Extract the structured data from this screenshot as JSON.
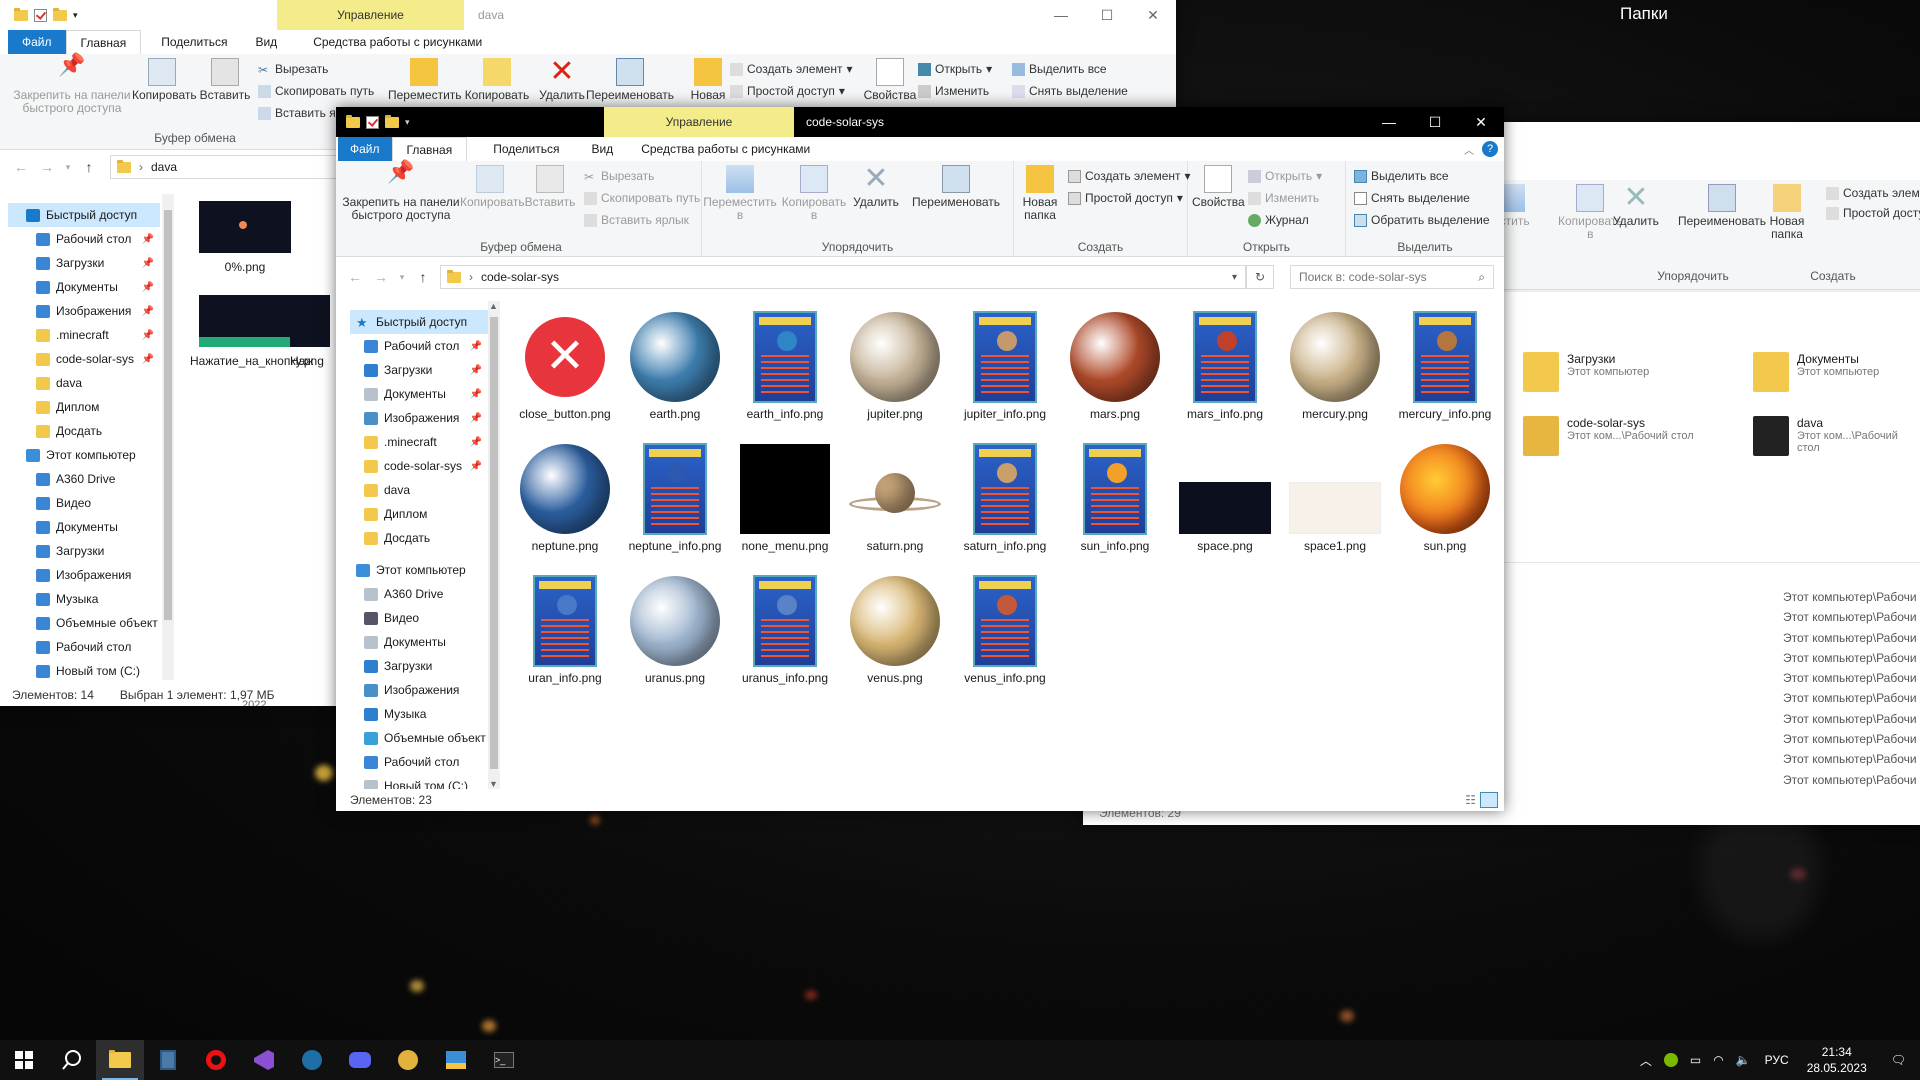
{
  "desktop": {
    "folders_label": "Папки"
  },
  "win_back": {
    "title": "dava",
    "manage_tab": "Управление",
    "tabs": [
      "Файл",
      "Главная",
      "Поделиться",
      "Вид",
      "Средства работы с рисунками"
    ],
    "ribbon": {
      "pin": "Закрепить на панели быстрого доступа",
      "copy": "Копировать",
      "paste": "Вставить",
      "cut": "Вырезать",
      "copy_path": "Скопировать путь",
      "paste_shortcut": "Вставить ярлык",
      "move": "Переместить",
      "copy_to": "Копировать",
      "delete": "Удалить",
      "rename": "Переименовать",
      "new_folder": "Новая",
      "new_item": "Создать элемент",
      "easy_access": "Простой доступ",
      "properties": "Свойства",
      "open": "Открыть",
      "edit": "Изменить",
      "select_all": "Выделить все",
      "select_none": "Снять выделение",
      "group_clipboard": "Буфер обмена"
    },
    "address": "dava",
    "nav": [
      "Быстрый доступ",
      "Рабочий стол",
      "Загрузки",
      "Документы",
      "Изображения",
      ".minecraft",
      "code-solar-sys",
      "dava",
      "Диплом",
      "Досдать",
      "Этот компьютер",
      "A360 Drive",
      "Видео",
      "Документы",
      "Загрузки",
      "Изображения",
      "Музыка",
      "Объемные объект",
      "Рабочий стол",
      "Новый том (C:)"
    ],
    "files": [
      "0%.png",
      "Нажатие_на_кнопку.png",
      "Наж"
    ],
    "status_count": "Элементов: 14",
    "status_selected": "Выбран 1 элемент: 1,97 МБ",
    "year_hint": "2022"
  },
  "win_right": {
    "ribbon": {
      "move": "естить",
      "copy": "Копировать",
      "copy_sub": "в",
      "delete": "Удалить",
      "rename": "Переименовать",
      "new_folder": "Новая папка",
      "new_item": "Создать элемент",
      "easy_access": "Простой доступ",
      "group_organize": "Упорядочить",
      "group_create": "Создать"
    },
    "tiles": [
      {
        "name": "Загрузки",
        "sub": "Этот компьютер"
      },
      {
        "name": "Документы",
        "sub": "Этот компьютер"
      },
      {
        "name": "code-solar-sys",
        "sub": "Этот ком...\\Рабочий стол"
      },
      {
        "name": "dava",
        "sub": "Этот ком...\\Рабочий стол"
      }
    ],
    "recent_paths": [
      "Этот компьютер\\Рабочи",
      "Этот компьютер\\Рабочи",
      "Этот компьютер\\Рабочи",
      "Этот компьютер\\Рабочи",
      "Этот компьютер\\Рабочи",
      "Этот компьютер\\Рабочи",
      "Этот компьютер\\Рабочи",
      "Этот компьютер\\Рабочи",
      "Этот компьютер\\Рабочи",
      "Этот компьютер\\Рабочи"
    ],
    "status_count": "Элементов: 29"
  },
  "win_main": {
    "title": "code-solar-sys",
    "manage_tab": "Управление",
    "tabs": [
      "Файл",
      "Главная",
      "Поделиться",
      "Вид",
      "Средства работы с рисунками"
    ],
    "ribbon": {
      "pin": "Закрепить на панели быстрого доступа",
      "copy": "Копировать",
      "paste": "Вставить",
      "cut": "Вырезать",
      "copy_path": "Скопировать путь",
      "paste_shortcut": "Вставить ярлык",
      "move": "Переместить в",
      "copy_to": "Копировать в",
      "delete": "Удалить",
      "rename": "Переименовать",
      "new_folder": "Новая папка",
      "new_item": "Создать элемент",
      "easy_access": "Простой доступ",
      "properties": "Свойства",
      "open": "Открыть",
      "edit": "Изменить",
      "history": "Журнал",
      "select_all": "Выделить все",
      "select_none": "Снять выделение",
      "invert": "Обратить выделение",
      "group_clipboard": "Буфер обмена",
      "group_organize": "Упорядочить",
      "group_create": "Создать",
      "group_open": "Открыть",
      "group_select": "Выделить"
    },
    "address": "code-solar-sys",
    "search_placeholder": "Поиск в: code-solar-sys",
    "nav": [
      {
        "label": "Быстрый доступ",
        "icon": "star-icon",
        "pin": false
      },
      {
        "label": "Рабочий стол",
        "icon": "desktop-icon",
        "pin": true
      },
      {
        "label": "Загрузки",
        "icon": "download-icon",
        "pin": true
      },
      {
        "label": "Документы",
        "icon": "document-icon",
        "pin": true
      },
      {
        "label": "Изображения",
        "icon": "pictures-icon",
        "pin": true
      },
      {
        "label": ".minecraft",
        "icon": "folder-icon",
        "pin": true
      },
      {
        "label": "code-solar-sys",
        "icon": "folder-icon",
        "pin": true
      },
      {
        "label": "dava",
        "icon": "folder-icon",
        "pin": false
      },
      {
        "label": "Диплом",
        "icon": "folder-icon",
        "pin": false
      },
      {
        "label": "Досдать",
        "icon": "folder-icon",
        "pin": false
      },
      {
        "label": "Этот компьютер",
        "icon": "computer-icon",
        "pin": false
      },
      {
        "label": "A360 Drive",
        "icon": "cloud-drive-icon",
        "pin": false
      },
      {
        "label": "Видео",
        "icon": "video-icon",
        "pin": false
      },
      {
        "label": "Документы",
        "icon": "document-icon",
        "pin": false
      },
      {
        "label": "Загрузки",
        "icon": "download-icon",
        "pin": false
      },
      {
        "label": "Изображения",
        "icon": "pictures-icon",
        "pin": false
      },
      {
        "label": "Музыка",
        "icon": "music-icon",
        "pin": false
      },
      {
        "label": "Объемные объект",
        "icon": "3d-objects-icon",
        "pin": false
      },
      {
        "label": "Рабочий стол",
        "icon": "desktop-icon",
        "pin": false
      },
      {
        "label": "Новый том (C:)",
        "icon": "drive-icon",
        "pin": false
      }
    ],
    "files": [
      {
        "name": "close_button.png",
        "kind": "close",
        "color": "#e8343c"
      },
      {
        "name": "earth.png",
        "kind": "planet",
        "color": "#3e7fb0"
      },
      {
        "name": "earth_info.png",
        "kind": "poster",
        "color": "#2f86c7"
      },
      {
        "name": "jupiter.png",
        "kind": "planet",
        "color": "#c7b59a"
      },
      {
        "name": "jupiter_info.png",
        "kind": "poster",
        "color": "#c49a6c"
      },
      {
        "name": "mars.png",
        "kind": "planet",
        "color": "#b04a2a"
      },
      {
        "name": "mars_info.png",
        "kind": "poster",
        "color": "#c0412b"
      },
      {
        "name": "mercury.png",
        "kind": "planet",
        "color": "#cbb38a"
      },
      {
        "name": "mercury_info.png",
        "kind": "poster",
        "color": "#b4763e"
      },
      {
        "name": "neptune.png",
        "kind": "planet",
        "color": "#2c5fa0"
      },
      {
        "name": "neptune_info.png",
        "kind": "poster",
        "color": "#2c58b0"
      },
      {
        "name": "none_menu.png",
        "kind": "black",
        "color": "#000000"
      },
      {
        "name": "saturn.png",
        "kind": "saturn",
        "color": "#c8a57a"
      },
      {
        "name": "saturn_info.png",
        "kind": "poster",
        "color": "#caa06a"
      },
      {
        "name": "sun_info.png",
        "kind": "poster",
        "color": "#f2a02a"
      },
      {
        "name": "space.png",
        "kind": "space",
        "color": "#0b0f1e"
      },
      {
        "name": "space1.png",
        "kind": "faint",
        "color": "#f7f1ea"
      },
      {
        "name": "sun.png",
        "kind": "sun",
        "color": "#f06a1a"
      },
      {
        "name": "uran_info.png",
        "kind": "poster",
        "color": "#4a78c8"
      },
      {
        "name": "uranus.png",
        "kind": "planet",
        "color": "#9fb6cf"
      },
      {
        "name": "uranus_info.png",
        "kind": "poster",
        "color": "#5a82c8"
      },
      {
        "name": "venus.png",
        "kind": "planet",
        "color": "#d9b774"
      },
      {
        "name": "venus_info.png",
        "kind": "poster",
        "color": "#c4583a"
      }
    ],
    "status_count": "Элементов: 23"
  },
  "taskbar": {
    "time": "21:34",
    "date": "28.05.2023",
    "lang": "РУС",
    "apps": [
      "start-icon",
      "search-icon",
      "file-explorer-icon",
      "calculator-icon",
      "opera-icon",
      "visual-studio-icon",
      "steam-icon",
      "discord-icon",
      "game-icon",
      "folder-app-icon",
      "terminal-icon"
    ]
  }
}
